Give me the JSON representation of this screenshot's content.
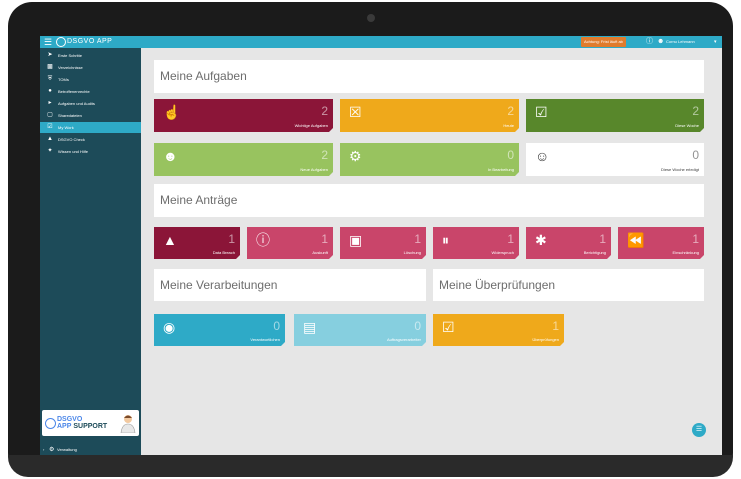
{
  "header": {
    "app_title": "DSGVO APP",
    "warning": "Achtung: Frist läuft ab",
    "user_name": "Cornu Lehmann"
  },
  "sidebar": {
    "items": [
      {
        "label": "Erste Schritte",
        "icon": "rocket-icon"
      },
      {
        "label": "Verzeichnisse",
        "icon": "chart-icon"
      },
      {
        "label": "TOMs",
        "icon": "shield-icon"
      },
      {
        "label": "Betroffenenrechte",
        "icon": "person-icon"
      },
      {
        "label": "Aufgaben und Audits",
        "icon": "caret-right-icon"
      },
      {
        "label": "Sharedateien",
        "icon": "folder-icon"
      },
      {
        "label": "My Work",
        "icon": "checkbox-icon"
      },
      {
        "label": "DSGVO Check",
        "icon": "warning-icon"
      },
      {
        "label": "Wissen und Hilfe",
        "icon": "pin-icon"
      }
    ],
    "support": {
      "line1": "DSGVO",
      "line2a": "APP",
      "line2b": "SUPPORT"
    },
    "admin_label": "Verwaltung"
  },
  "aufgaben": {
    "title": "Meine Aufgaben",
    "tiles": [
      {
        "label": "Wichtige Aufgaben",
        "count": "2",
        "color": "#8b1538",
        "icon": "hand-pointer-icon"
      },
      {
        "label": "Heute",
        "count": "2",
        "color": "#efa91b",
        "icon": "calendar-x-icon"
      },
      {
        "label": "Diese Woche",
        "count": "2",
        "color": "#58872b",
        "icon": "calendar-check-icon"
      },
      {
        "label": "Neue Aufgaben",
        "count": "2",
        "color": "#98c35f",
        "icon": "user-plus-icon"
      },
      {
        "label": "In Bearbeitung",
        "count": "0",
        "color": "#98c35f",
        "icon": "cogs-icon"
      },
      {
        "label": "Diese Woche erledigt",
        "count": "0",
        "color": "#ffffff",
        "icon": "smile-icon"
      }
    ]
  },
  "antraege": {
    "title": "Meine Anträge",
    "tiles": [
      {
        "label": "Data Breach",
        "count": "1",
        "color": "#8b1538",
        "icon": "warning-icon"
      },
      {
        "label": "Auskunft",
        "count": "1",
        "color": "#c9456a",
        "icon": "info-icon"
      },
      {
        "label": "Löschung",
        "count": "1",
        "color": "#c9456a",
        "icon": "stop-icon"
      },
      {
        "label": "Widerspruch",
        "count": "1",
        "color": "#c9456a",
        "icon": "pause-icon"
      },
      {
        "label": "Berichtigung",
        "count": "1",
        "color": "#c9456a",
        "icon": "bug-icon"
      },
      {
        "label": "Einschränkung",
        "count": "1",
        "color": "#c9456a",
        "icon": "backward-icon"
      }
    ]
  },
  "verarbeitungen": {
    "title": "Meine Verarbeitungen",
    "tiles": [
      {
        "label": "Verantwortlichen",
        "count": "0",
        "color": "#2eaac7",
        "icon": "binoculars-icon"
      },
      {
        "label": "Auftragsverarbeiter",
        "count": "0",
        "color": "#86cfdf",
        "icon": "archive-icon"
      }
    ]
  },
  "ueberpruefungen": {
    "title": "Meine Überprüfungen",
    "tiles": [
      {
        "label": "Überprüfungen",
        "count": "1",
        "color": "#efa91b",
        "icon": "calendar-check-icon"
      }
    ]
  }
}
